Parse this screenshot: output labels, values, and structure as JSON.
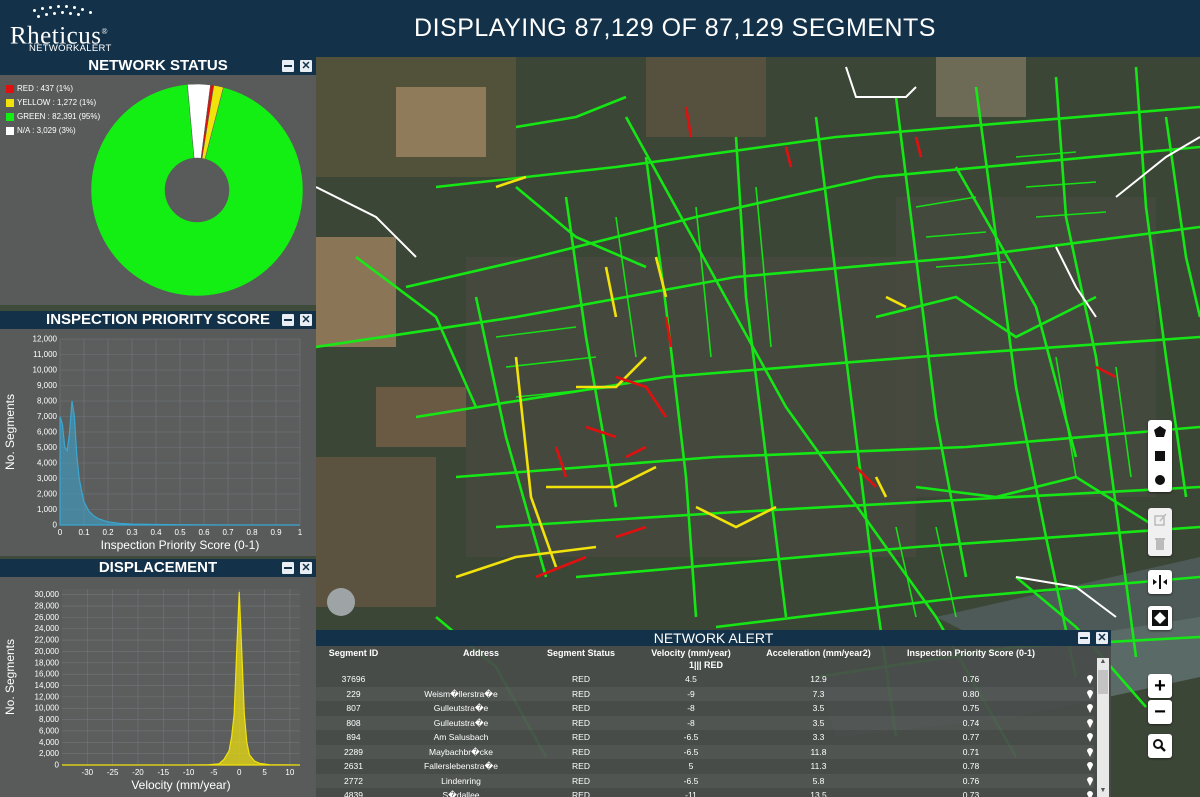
{
  "logo": {
    "name": "Rheticus",
    "reg": "®",
    "sub": "NETWORKALERT"
  },
  "title": "DISPLAYING 87,129 OF 87,129 SEGMENTS",
  "colors": {
    "red": "#e01010",
    "yellow": "#f2e20c",
    "green": "#13ef13",
    "na": "#ffffff",
    "header": "#133249"
  },
  "network_status": {
    "title": "NETWORK STATUS",
    "legend": [
      {
        "label": "RED : 437 (1%)",
        "color": "#e01010"
      },
      {
        "label": "YELLOW : 1,272 (1%)",
        "color": "#f2e20c"
      },
      {
        "label": "GREEN : 82,391 (95%)",
        "color": "#13ef13"
      },
      {
        "label": "N/A : 3,029 (3%)",
        "color": "#ffffff"
      }
    ]
  },
  "inspection": {
    "title": "INSPECTION PRIORITY SCORE"
  },
  "displacement": {
    "title": "DISPLACEMENT"
  },
  "chart_data": [
    {
      "type": "pie",
      "title": "NETWORK STATUS",
      "categories": [
        "RED",
        "YELLOW",
        "GREEN",
        "N/A"
      ],
      "values": [
        437,
        1272,
        82391,
        3029
      ],
      "colors": [
        "#e01010",
        "#f2e20c",
        "#13ef13",
        "#ffffff"
      ],
      "donut": true
    },
    {
      "type": "area",
      "xlabel": "Inspection Priority Score (0-1)",
      "ylabel": "No. Segments",
      "xlim": [
        0,
        1
      ],
      "ylim": [
        0,
        12000
      ],
      "xticks": [
        "0",
        "0.1",
        "0.2",
        "0.3",
        "0.4",
        "0.5",
        "0.6",
        "0.7",
        "0.8",
        "0.9",
        "1"
      ],
      "yticks": [
        "0",
        "1,000",
        "2,000",
        "3,000",
        "4,000",
        "5,000",
        "6,000",
        "7,000",
        "8,000",
        "9,000",
        "10,000",
        "11,000",
        "12,000"
      ],
      "grid": true,
      "x": [
        0,
        0.01,
        0.02,
        0.03,
        0.04,
        0.05,
        0.06,
        0.07,
        0.08,
        0.09,
        0.1,
        0.12,
        0.14,
        0.16,
        0.18,
        0.2,
        0.25,
        0.3,
        0.4,
        0.5,
        0.6,
        0.7,
        0.8,
        0.9,
        1
      ],
      "y": [
        7000,
        6500,
        5000,
        4800,
        6000,
        8000,
        7000,
        4500,
        3000,
        2200,
        1500,
        900,
        600,
        400,
        300,
        200,
        100,
        60,
        30,
        20,
        10,
        5,
        0,
        0,
        0
      ],
      "color": "#3aa7d2"
    },
    {
      "type": "area",
      "xlabel": "Velocity (mm/year)",
      "ylabel": "No. Segments",
      "xlim": [
        -35,
        12
      ],
      "ylim": [
        0,
        31000
      ],
      "xticks": [
        "-30",
        "-25",
        "-20",
        "-15",
        "-10",
        "-5",
        "0",
        "5",
        "10"
      ],
      "yticks": [
        "0",
        "2,000",
        "4,000",
        "6,000",
        "8,000",
        "10,000",
        "12,000",
        "14,000",
        "16,000",
        "18,000",
        "20,000",
        "22,000",
        "24,000",
        "26,000",
        "28,000",
        "30,000"
      ],
      "grid": true,
      "x": [
        -35,
        -10,
        -6,
        -4,
        -3,
        -2,
        -1.5,
        -1,
        -0.5,
        0,
        0.5,
        1,
        1.5,
        2,
        3,
        4,
        6,
        12
      ],
      "y": [
        0,
        0,
        50,
        200,
        1000,
        2500,
        5000,
        9000,
        20000,
        30500,
        20000,
        9000,
        4000,
        1800,
        700,
        300,
        50,
        0
      ],
      "color": "#f2e20c"
    }
  ],
  "alert": {
    "title": "NETWORK ALERT",
    "columns": [
      "Segment ID",
      "Address",
      "Segment Status",
      "Velocity (mm/year)",
      "Acceleration (mm/year2)",
      "Inspection Priority Score (0-1)"
    ],
    "sort_label": "1||| RED",
    "rows": [
      [
        "37696",
        "",
        "RED",
        "4.5",
        "12.9",
        "0.76"
      ],
      [
        "229",
        "Weism�llerstra�e",
        "RED",
        "-9",
        "7.3",
        "0.80"
      ],
      [
        "807",
        "Gulleutstra�e",
        "RED",
        "-8",
        "3.5",
        "0.75"
      ],
      [
        "808",
        "Gulleutstra�e",
        "RED",
        "-8",
        "3.5",
        "0.74"
      ],
      [
        "894",
        "Am Salusbach",
        "RED",
        "-6.5",
        "3.3",
        "0.77"
      ],
      [
        "2289",
        "Maybachbr�cke",
        "RED",
        "-6.5",
        "11.8",
        "0.71"
      ],
      [
        "2631",
        "Fallerslebenstra�e",
        "RED",
        "5",
        "11.3",
        "0.78"
      ],
      [
        "2772",
        "Lindenring",
        "RED",
        "-6.5",
        "5.8",
        "0.76"
      ],
      [
        "4839",
        "S�dallee",
        "RED",
        "-11",
        "13.5",
        "0.73"
      ]
    ]
  },
  "tools": [
    "polygon-draw-icon",
    "square-draw-icon",
    "circle-draw-icon",
    "edit-icon",
    "delete-icon",
    "swipe-icon",
    "fullscreen-icon",
    "zoom-in-icon",
    "zoom-out-icon",
    "search-icon"
  ],
  "zoom": {
    "in": "+",
    "out": "−"
  }
}
